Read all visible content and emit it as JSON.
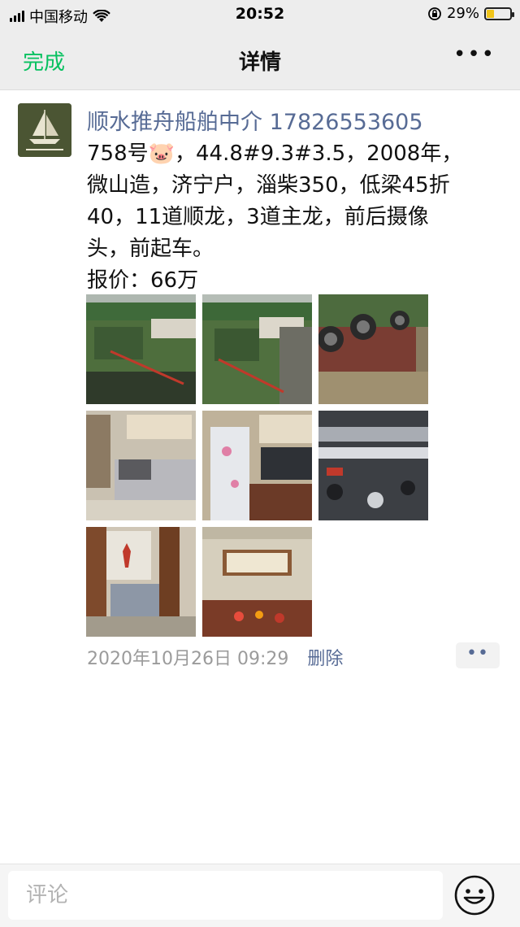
{
  "status_bar": {
    "carrier": "中国移动",
    "time": "20:52",
    "battery_percent": "29%"
  },
  "nav": {
    "done": "完成",
    "title": "详情",
    "more": "•••"
  },
  "post": {
    "name": "顺水推舟船舶中介 17826553605",
    "lines": [
      "758号🐷，44.8#9.3#3.5，2008年，",
      "微山造，济宁户，淄柴350，低梁45折",
      "40，11道顺龙，3道主龙，前后摄像",
      "头，前起车。",
      "报价：66万"
    ],
    "timestamp": "2020年10月26日 09:29",
    "delete": "删除",
    "more_button": "••"
  },
  "comment": {
    "placeholder": "评论"
  },
  "icons": {
    "signal": "signal-icon",
    "wifi": "wifi-icon",
    "rotation_lock": "rotation-lock-icon",
    "battery": "battery-icon",
    "emoji": "emoji-icon"
  },
  "colors": {
    "accent_green": "#07c160",
    "link_blue": "#576b95",
    "battery_fill": "#f0c419"
  }
}
